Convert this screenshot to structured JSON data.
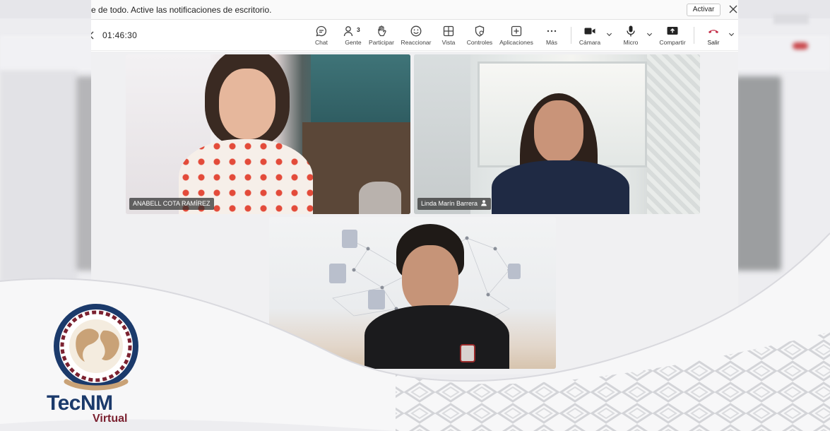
{
  "notification": {
    "text": "e de todo. Active las notificaciones de escritorio.",
    "activate_label": "Activar"
  },
  "meeting": {
    "timer": "01:46:30",
    "tools": {
      "chat": "Chat",
      "people": "Gente",
      "people_count": "3",
      "raise": "Participar",
      "react": "Reaccionar",
      "view": "Vista",
      "controls": "Controles",
      "apps": "Aplicaciones",
      "more": "Más",
      "camera": "Cámara",
      "mic": "Micro",
      "share": "Compartir",
      "leave": "Salir"
    },
    "accent": "#c4314b"
  },
  "participants": [
    {
      "name": "ANABELL COTA RAMÍREZ"
    },
    {
      "name": "Linda Marín Barrera"
    },
    {
      "name": ""
    }
  ],
  "branding": {
    "name": "TecNM",
    "sub": "Virtual",
    "primary": "#1b3a6b",
    "secondary": "#7b2130"
  }
}
